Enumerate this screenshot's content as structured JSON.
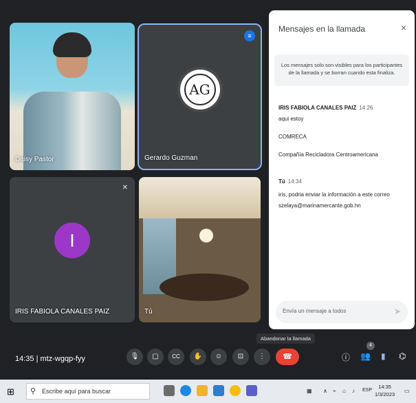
{
  "participants": [
    {
      "name": "Daisy Pastor"
    },
    {
      "name": "Gerardo Guzman"
    },
    {
      "name": "IRIS FABIOLA CANALES PAIZ",
      "initial": "I"
    },
    {
      "name": "Tú"
    }
  ],
  "logo_text": "AG",
  "chat": {
    "title": "Mensajes en la llamada",
    "close_icon": "×",
    "note": "Los mensajes solo son visibles para los participantes de la llamada y se borran cuando esta finaliza.",
    "messages": [
      {
        "author": "IRIS FABIOLA CANALES PAIZ",
        "time": "14:26",
        "lines": [
          "aqui estoy",
          "COMRECA",
          "Compañía Recicladora Centroamericana"
        ]
      },
      {
        "author": "Tú",
        "time": "14:34",
        "lines": [
          "iris, podria enviar la información a este correo",
          "szelaya@marinamercante.gob.hn"
        ]
      }
    ],
    "input_placeholder": "Envía un mensaje a todos",
    "send_icon": "send-icon"
  },
  "tooltip": "Abandonar la llamada",
  "meeting": {
    "time": "14:35",
    "separator": "|",
    "code": "mtz-wgqp-fyy"
  },
  "controls": {
    "mic": "🎙",
    "camera": "▢",
    "captions": "CC",
    "hand": "✋",
    "emoji": "☺",
    "present": "⊡",
    "more": "⋮",
    "end": "☎",
    "info": "ⓘ",
    "people_count": "4",
    "people": "👥",
    "chat": "▮",
    "activities": "⌬"
  },
  "taskbar": {
    "search_placeholder": "Escribe aquí para buscar",
    "lang": "ESP",
    "time": "14:35",
    "date": "1/3/2023"
  },
  "colors": {
    "accent": "#8ab4f8",
    "end_call": "#ea4335",
    "avatar": "#9c37c8"
  }
}
